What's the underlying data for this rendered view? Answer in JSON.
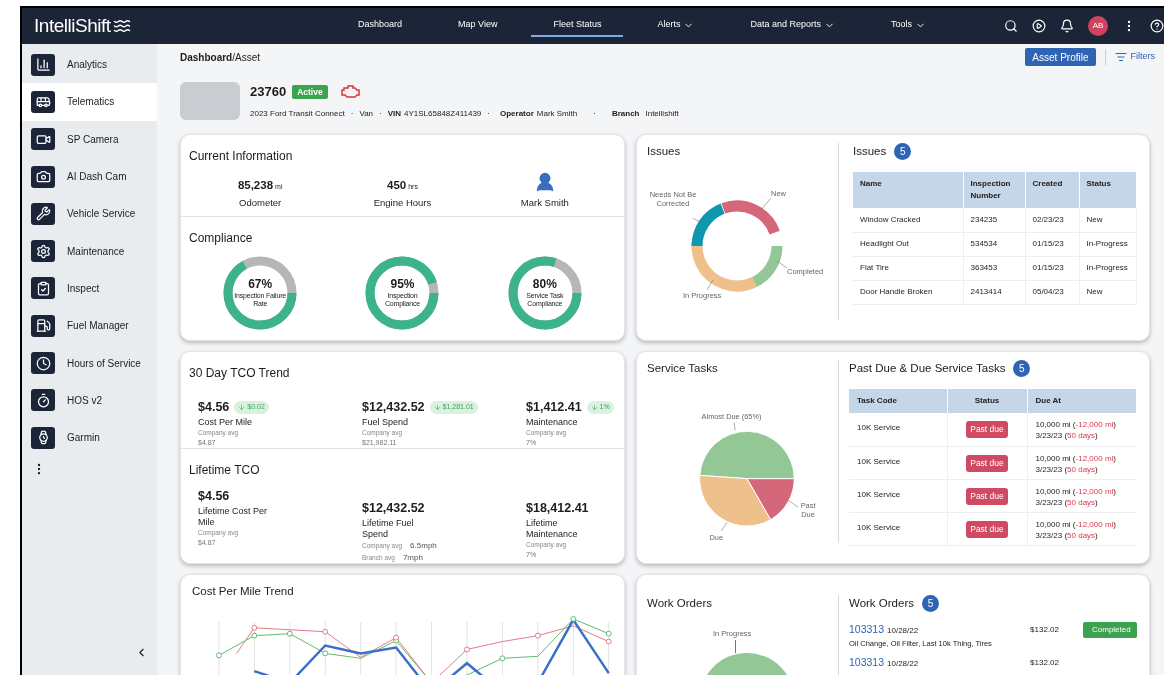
{
  "brand": {
    "name": "IntelliShift"
  },
  "nav": [
    {
      "label": "Dashboard",
      "selected": false,
      "dropdown": false
    },
    {
      "label": "Map View",
      "selected": false,
      "dropdown": false
    },
    {
      "label": "Fleet Status",
      "selected": true,
      "dropdown": false
    },
    {
      "label": "Alerts",
      "selected": false,
      "dropdown": true
    },
    {
      "label": "Data and Reports",
      "selected": false,
      "dropdown": true
    },
    {
      "label": "Tools",
      "selected": false,
      "dropdown": true
    }
  ],
  "user": {
    "initials": "AB"
  },
  "sidebar": {
    "items": [
      {
        "label": "Analytics",
        "selected": false
      },
      {
        "label": "Telematics",
        "selected": true
      },
      {
        "label": "SP Camera",
        "selected": false
      },
      {
        "label": "AI Dash Cam",
        "selected": false
      },
      {
        "label": "Vehicle Service",
        "selected": false
      },
      {
        "label": "Maintenance",
        "selected": false
      },
      {
        "label": "Inspect",
        "selected": false
      },
      {
        "label": "Fuel Manager",
        "selected": false
      },
      {
        "label": "Hours of Service",
        "selected": false
      },
      {
        "label": "HOS v2",
        "selected": false
      },
      {
        "label": "Garmin",
        "selected": false
      }
    ]
  },
  "breadcrumb": {
    "parent": "Dashboard",
    "separator": "/",
    "current": "Asset"
  },
  "actions": {
    "profile": "Asset Profile",
    "filters": "Filters"
  },
  "asset": {
    "number": "23760",
    "status": "Active",
    "engine_warning": true,
    "model": "2023 Ford Transit Connect",
    "dot": "·",
    "type": "Van",
    "vin_label": "VIN",
    "vin": "4Y1SL65848Z411439",
    "operator_label": "Operator",
    "operator": "Mark Smith",
    "branch_label": "Branch",
    "branch": "Intellishift"
  },
  "current_information": {
    "title": "Current Information",
    "stats": [
      {
        "value": "85,238",
        "unit": "mi",
        "label": "Odometer"
      },
      {
        "value": "450",
        "unit": "hrs",
        "label": "Engine Hours"
      }
    ],
    "driver": "Mark Smith"
  },
  "compliance": {
    "title": "Compliance",
    "gauges": [
      {
        "reading": "67%",
        "label": "Inspection Failure Rate",
        "level": 0.67
      },
      {
        "reading": "95%",
        "label": "Inspection Compliance",
        "level": 0.95
      },
      {
        "reading": "80%",
        "label": "Service Task Compliance",
        "level": 0.8
      }
    ]
  },
  "issues": {
    "chart_title": "Issues",
    "chart_labels": [
      "New",
      "Completed",
      "In Progress",
      "Needs Not Be Corrected"
    ],
    "table_title": "Issues",
    "count": "5",
    "columns": [
      "Name",
      "Inspection Number",
      "Created",
      "Status"
    ],
    "rows": [
      [
        "Window Cracked",
        "234235",
        "02/23/23",
        "New"
      ],
      [
        "Headlight Out",
        "534534",
        "01/15/23",
        "In-Progress"
      ],
      [
        "Flat Tire",
        "363453",
        "01/15/23",
        "In-Progress"
      ],
      [
        "Door Handle Broken",
        "2413414",
        "05/04/23",
        "New"
      ]
    ]
  },
  "tco_30_day": {
    "title": "30 Day TCO Trend",
    "metrics": [
      {
        "value": "$4.56",
        "change": "$0.02",
        "label": "Cost Per Mile",
        "averages": [
          {
            "label": "Company avg",
            "value": "$4.87"
          }
        ]
      },
      {
        "value": "$12,432.52",
        "change": "$1,281.01",
        "label": "Fuel Spend",
        "averages": [
          {
            "label": "Company avg",
            "value": "$21,982.11"
          }
        ]
      },
      {
        "value": "$1,412.41",
        "change": "1%",
        "label": "Maintenance",
        "averages": [
          {
            "label": "Company avg",
            "value": "7%"
          }
        ]
      }
    ]
  },
  "lifetime_tco": {
    "title": "Lifetime TCO",
    "metrics": [
      {
        "value": "$4.56",
        "label": "Lifetime Cost Per Mile",
        "averages": [
          {
            "label": "Company avg",
            "value": "$4.87"
          }
        ]
      },
      {
        "value": "$12,432.52",
        "label": "Lifetime Fuel Spend",
        "averages": [
          {
            "label": "Company avg",
            "value": "6.5mph"
          },
          {
            "label": "Branch avg",
            "value": "7mph"
          }
        ]
      },
      {
        "value": "$18,412.41",
        "label": "Lifetime Maintenance",
        "averages": [
          {
            "label": "Company avg",
            "value": "7%"
          }
        ]
      }
    ]
  },
  "service_tasks": {
    "chart_title": "Service Tasks",
    "chart_labels": [
      "Almost Due (65%)",
      "Past Due",
      "Due"
    ],
    "table_title": "Past Due & Due Service Tasks",
    "count": "5",
    "columns": [
      "Task Code",
      "Status",
      "Due At"
    ],
    "rows": [
      {
        "task": "10K Service",
        "status": "Past due",
        "lines": [
          [
            {
              "text": "10,000 mi (",
              "overdue": false
            },
            {
              "text": "-12,000 mi",
              "overdue": true
            },
            {
              "text": ")",
              "overdue": false
            }
          ],
          [
            {
              "text": "3/23/23 (",
              "overdue": false
            },
            {
              "text": "50 days",
              "overdue": true
            },
            {
              "text": ")",
              "overdue": false
            }
          ]
        ]
      },
      {
        "task": "10K Service",
        "status": "Past due",
        "lines": [
          [
            {
              "text": "10,000 mi (",
              "overdue": false
            },
            {
              "text": "-12,000 mi",
              "overdue": true
            },
            {
              "text": ")",
              "overdue": false
            }
          ],
          [
            {
              "text": "3/23/23 (",
              "overdue": false
            },
            {
              "text": "50 days",
              "overdue": true
            },
            {
              "text": ")",
              "overdue": false
            }
          ]
        ]
      },
      {
        "task": "10K Service",
        "status": "Past due",
        "lines": [
          [
            {
              "text": "10,000 mi (",
              "overdue": false
            },
            {
              "text": "-12,000 mi",
              "overdue": true
            },
            {
              "text": ")",
              "overdue": false
            }
          ],
          [
            {
              "text": "3/23/23 (",
              "overdue": false
            },
            {
              "text": "50 days",
              "overdue": true
            },
            {
              "text": ")",
              "overdue": false
            }
          ]
        ]
      },
      {
        "task": "10K Service",
        "status": "Past due",
        "lines": [
          [
            {
              "text": "10,000 mi (",
              "overdue": false
            },
            {
              "text": "-12,000 mi",
              "overdue": true
            },
            {
              "text": ")",
              "overdue": false
            }
          ],
          [
            {
              "text": "3/23/23 (",
              "overdue": false
            },
            {
              "text": "50 days",
              "overdue": true
            },
            {
              "text": ")",
              "overdue": false
            }
          ]
        ]
      }
    ]
  },
  "cost_per_mile_trend": {
    "title": "Cost Per Mile Trend"
  },
  "work_orders": {
    "chart_title": "Work Orders",
    "chart_labels": [
      "In Progress"
    ],
    "list_title": "Work Orders",
    "count": "5",
    "orders": [
      {
        "number": "103313",
        "date": "10/28/22",
        "description": "Oil Change, Oil Filter, Last 10k Thing, Tires",
        "amount": "$132.02",
        "status": "Completed"
      },
      {
        "number": "103313",
        "date": "10/28/22",
        "amount": "$132.02"
      }
    ]
  }
}
